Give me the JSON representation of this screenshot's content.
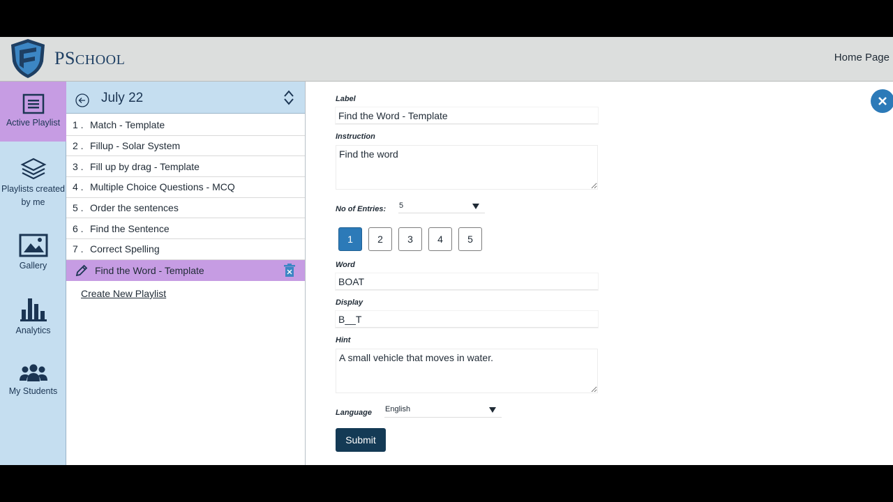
{
  "header": {
    "brand_initial": "PS",
    "brand_rest": "CHOOL",
    "home_link": "Home Page"
  },
  "leftnav": {
    "items": [
      {
        "label": "Active Playlist",
        "icon": "list-icon"
      },
      {
        "label": "Playlists created by me",
        "icon": "layers-icon"
      },
      {
        "label": "Gallery",
        "icon": "image-icon"
      },
      {
        "label": "Analytics",
        "icon": "bar-chart-icon"
      },
      {
        "label": "My Students",
        "icon": "users-icon"
      }
    ]
  },
  "playlist": {
    "title": "July 22",
    "items": [
      {
        "num": "1 .",
        "label": "Match - Template"
      },
      {
        "num": "2 .",
        "label": "Fillup - Solar System"
      },
      {
        "num": "3 .",
        "label": "Fill up by drag - Template"
      },
      {
        "num": "4 .",
        "label": "Multiple Choice Questions - MCQ"
      },
      {
        "num": "5 .",
        "label": "Order the sentences"
      },
      {
        "num": "6 .",
        "label": "Find the Sentence"
      },
      {
        "num": "7 .",
        "label": "Correct Spelling"
      }
    ],
    "active_item": "Find the Word - Template",
    "create_link": "Create New Playlist"
  },
  "form": {
    "label_title": "Label",
    "label_value": "Find the Word - Template",
    "instruction_title": "Instruction",
    "instruction_value": "Find the word",
    "entries_title": "No of Entries:",
    "entries_value": "5",
    "entry_buttons": [
      "1",
      "2",
      "3",
      "4",
      "5"
    ],
    "active_entry": "1",
    "word_title": "Word",
    "word_value": "BOAT",
    "display_title": "Display",
    "display_value": "B__T",
    "hint_title": "Hint",
    "hint_value": "A small vehicle that moves in water.",
    "language_title": "Language",
    "language_value": "English",
    "submit_label": "Submit"
  },
  "colors": {
    "nav_bg": "#c5def0",
    "active_bg": "#c69ce3",
    "primary": "#2c7ab8",
    "submit": "#143a55",
    "brand": "#1e3f63"
  }
}
